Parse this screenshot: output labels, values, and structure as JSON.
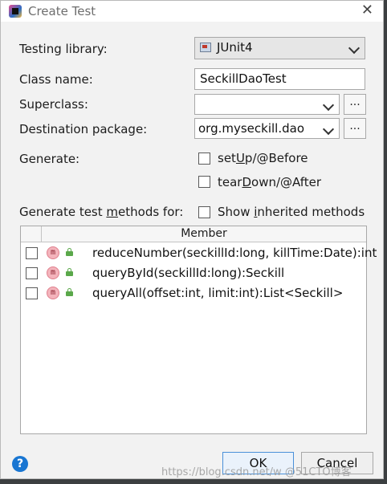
{
  "window": {
    "title": "Create Test",
    "close_glyph": "✕"
  },
  "form": {
    "testing_library_label": "Testing library:",
    "testing_library_value": "JUnit4",
    "class_name_label": "Class name:",
    "class_name_value": "SeckillDaoTest",
    "superclass_label": "Superclass:",
    "superclass_value": "",
    "destination_label": "Destination package:",
    "destination_value": "org.myseckill.dao",
    "browse_label": "...",
    "generate_label": "Generate:",
    "setup": {
      "pre": "set",
      "mnemonic": "U",
      "post": "p/@Before",
      "checked": false
    },
    "teardown": {
      "pre": "tear",
      "mnemonic": "D",
      "post": "own/@After",
      "checked": false
    },
    "methods_label": {
      "pre": "Generate test ",
      "mnemonic": "m",
      "post": "ethods for:"
    },
    "inherited": {
      "pre": "Show ",
      "mnemonic": "i",
      "post": "nherited methods",
      "checked": false
    }
  },
  "table": {
    "header": "Member",
    "method_icon_letter": "m",
    "rows": [
      {
        "signature": "reduceNumber(seckillId:long, killTime:Date):int",
        "checked": false
      },
      {
        "signature": "queryById(seckillId:long):Seckill",
        "checked": false
      },
      {
        "signature": "queryAll(offset:int, limit:int):List<Seckill>",
        "checked": false
      }
    ]
  },
  "footer": {
    "help_glyph": "?",
    "ok_label": "OK",
    "cancel_label": "Cancel",
    "watermark": "https://blog.csdn.net/w @51CTO博客"
  },
  "icons": {
    "app": "intellij-idea-icon",
    "junit": "junit-library-icon",
    "method": "method-icon",
    "visibility": "public-lock-icon",
    "help": "help-icon"
  }
}
